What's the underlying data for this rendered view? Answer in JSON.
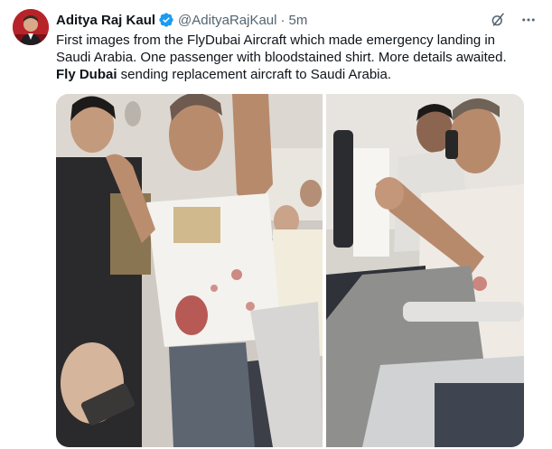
{
  "author": {
    "display_name": "Aditya Raj Kaul",
    "handle": "@AdityaRajKaul",
    "separator": "·",
    "time": "5m",
    "verified": true,
    "avatar_bg": "#b8232a"
  },
  "tweet": {
    "line1": "First images from the FlyDubai Aircraft which made emergency landing in",
    "line2": "Saudi Arabia. One passenger with bloodstained shirt. More details awaited.",
    "bold_text": "Fly Dubai",
    "line3_rest": " sending replacement aircraft to Saudi Arabia."
  },
  "header_icons": [
    "grok-icon",
    "more-options-icon"
  ],
  "media": {
    "count": 2,
    "items": [
      "photo-passenger-standing",
      "photo-passenger-seated"
    ]
  },
  "colors": {
    "verified_blue": "#1d9bf0",
    "secondary_text": "#536471",
    "primary_text": "#0f1419"
  }
}
